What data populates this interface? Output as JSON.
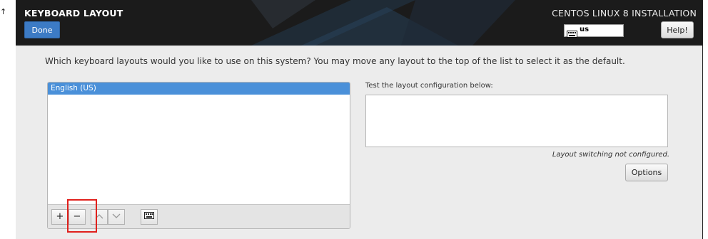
{
  "header": {
    "screen_title": "KEYBOARD LAYOUT",
    "done_label": "Done",
    "product_title": "CENTOS LINUX 8 INSTALLATION",
    "keyboard_indicator": "us",
    "help_label": "Help!"
  },
  "main": {
    "prompt": "Which keyboard layouts would you like to use on this system?  You may move any layout to the top of the list to select it as the default.",
    "layouts": [
      "English (US)"
    ],
    "toolbar": {
      "add_label": "+",
      "remove_label": "−",
      "up_label": "^",
      "down_label": "v"
    },
    "test_label": "Test the layout configuration below:",
    "test_value": "",
    "switching_note": "Layout switching not configured.",
    "options_label": "Options"
  },
  "colors": {
    "header_bg": "#1b1b1b",
    "accent_blue": "#3c7bc5",
    "selected_row": "#4a90d9",
    "highlight_red": "#e0201c"
  },
  "icons": {
    "keyboard": "keyboard-icon",
    "up": "chevron-up-icon",
    "down": "chevron-down-icon"
  }
}
